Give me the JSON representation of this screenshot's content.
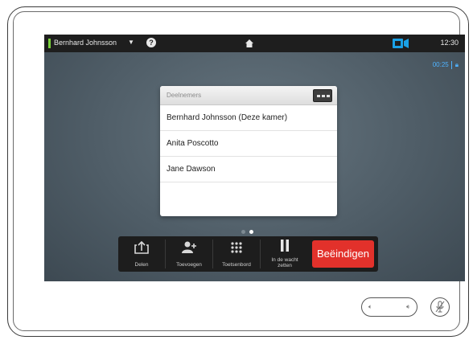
{
  "topbar": {
    "caller_name": "Bernhard Johnsson",
    "caret": "▼",
    "help_glyph": "?",
    "time": "12:30",
    "status_color": "#7ad13b",
    "camera_color": "#1aa1e6"
  },
  "call": {
    "duration": "00:25"
  },
  "participants": {
    "title": "Deelnemers",
    "items": [
      "Bernhard Johnsson (Deze kamer)",
      "Anita Poscotto",
      "Jane Dawson"
    ]
  },
  "pagination": {
    "pages": 2,
    "active_page": 2
  },
  "toolbar": {
    "share_label": "Delen",
    "add_label": "Toevoegen",
    "keypad_label": "Toetsenbord",
    "hold_label_1": "In de wacht",
    "hold_label_2": "zetten",
    "end_label": "Beëindigen",
    "end_color": "#e2312b"
  },
  "hardware": {
    "volume_down_icon": "speaker-low-icon",
    "volume_up_icon": "speaker-high-icon",
    "mute_icon": "mic-muted-icon"
  }
}
